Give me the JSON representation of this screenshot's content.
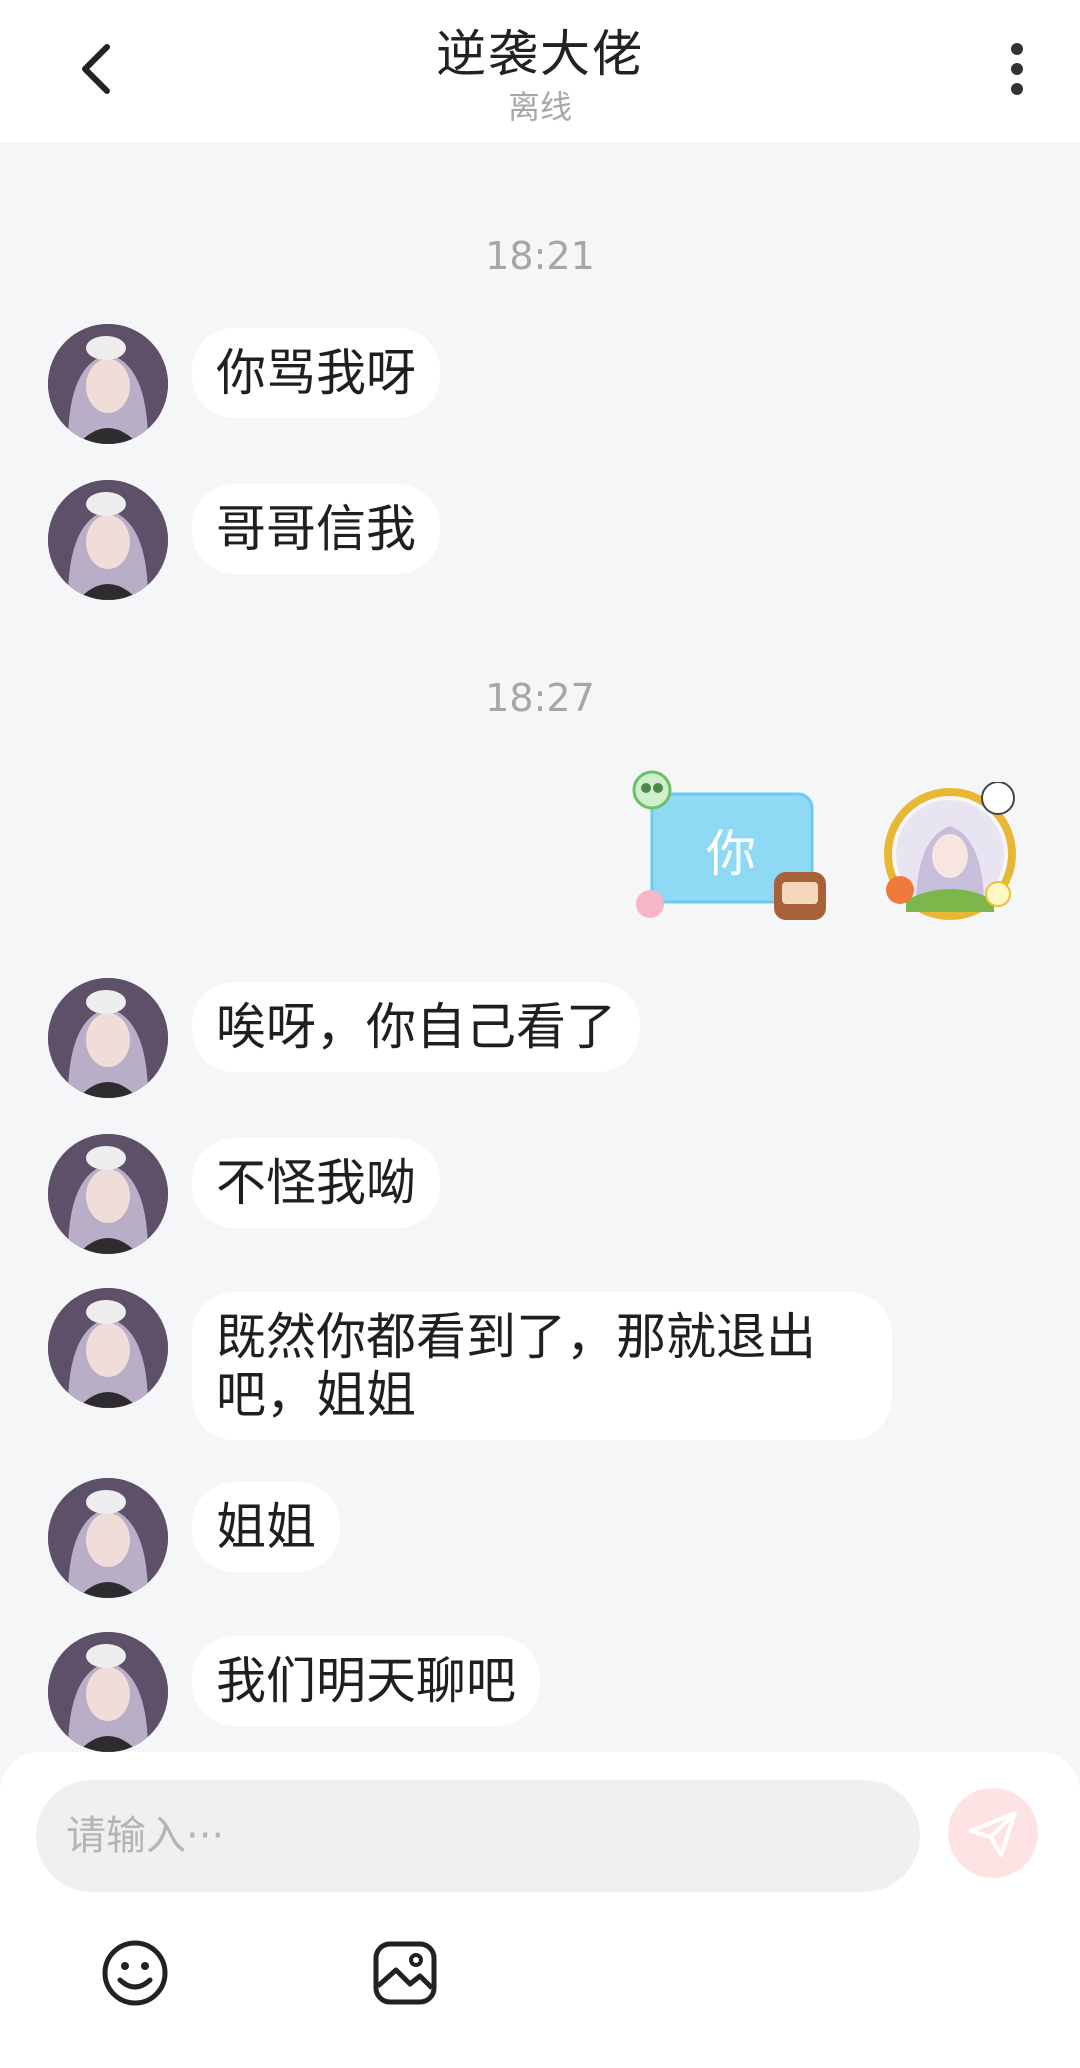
{
  "header": {
    "title": "逆袭大佬",
    "status": "离线",
    "back_icon": "chevron-left-icon",
    "more_icon": "more-vertical-icon"
  },
  "messages": {
    "time1": "18:21",
    "m1": "你骂我呀",
    "m2": "哥哥信我",
    "time2": "18:27",
    "sticker_text": "你",
    "m3": "唉呀，你自己看了",
    "m4": "不怪我呦",
    "m5": "既然你都看到了，那就退出吧，姐姐",
    "m6": "姐姐",
    "m7": "我们明天聊吧"
  },
  "input": {
    "placeholder": "请输入···",
    "value": ""
  },
  "toolbar": {
    "emoji_icon": "emoji-icon",
    "image_icon": "image-icon",
    "send_icon": "send-icon"
  },
  "colors": {
    "background": "#f5f6f8",
    "bubble": "#ffffff",
    "send_button": "#fde3e3",
    "sticker_blue": "#8fd9f5"
  }
}
